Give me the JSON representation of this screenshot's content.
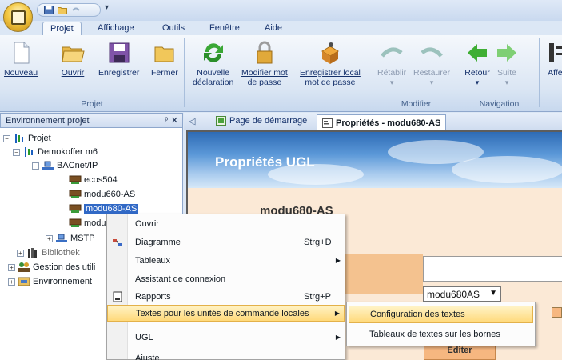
{
  "tabs": {
    "projet": "Projet",
    "affichage": "Affichage",
    "outils": "Outils",
    "fenetre": "Fenêtre",
    "aide": "Aide"
  },
  "ribbon": {
    "nouveau": "Nouveau",
    "ouvrir": "Ouvrir",
    "enregistrer": "Enregistrer",
    "fermer": "Fermer",
    "nouvelle_declaration_1": "Nouvelle",
    "nouvelle_declaration_2": "déclaration",
    "modifier_mdp_1": "Modifier mot",
    "modifier_mdp_2": "de passe",
    "enregistrer_local_1": "Enregistrer local",
    "enregistrer_local_2": "mot de passe",
    "retablir": "Rétablir",
    "restaurer": "Restaurer",
    "retour": "Retour",
    "suite": "Suite",
    "affect": "Affec",
    "group_projet": "Projet",
    "group_modifier": "Modifier",
    "group_navigation": "Navigation"
  },
  "panel": {
    "title": "Environnement projet",
    "pin": "ᵖ",
    "close": "✕"
  },
  "tree": {
    "projet": "Projet",
    "demokoffer": "Demokoffer m6",
    "bacnet": "BACnet/IP",
    "ecos504": "ecos504",
    "modu660": "modu660-AS",
    "modu680": "modu680-AS",
    "modu_partial": "modu",
    "mstp": "MSTP",
    "bibliothek": "Bibliothek",
    "gestion": "Gestion des utili",
    "environnement": "Environnement"
  },
  "doctabs": {
    "demarrage": "Page de démarrage",
    "proprietes": "Propriétés - modu680-AS"
  },
  "page": {
    "banner_title": "Propriétés UGL",
    "heading": "modu680-AS",
    "select_value": "modu680AS",
    "edit_button": "Editer"
  },
  "menu": {
    "ouvrir": "Ouvrir",
    "diagramme": "Diagramme",
    "diagramme_sc": "Strg+D",
    "tableaux": "Tableaux",
    "assistant": "Assistant de connexion",
    "rapports": "Rapports",
    "rapports_sc": "Strg+P",
    "textes": "Textes pour les unités de commande locales",
    "ugl": "UGL",
    "partial": "Ajuste"
  },
  "submenu": {
    "config": "Configuration des textes",
    "tableaux_bornes": "Tableaux de textes sur les bornes"
  }
}
